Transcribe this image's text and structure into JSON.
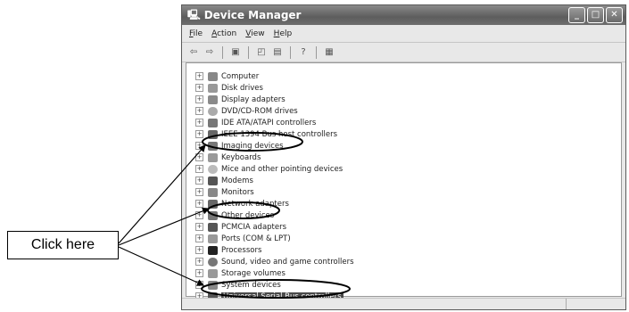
{
  "window": {
    "title": "Device Manager",
    "buttons": {
      "minimize": "_",
      "maximize": "□",
      "close": "✕"
    }
  },
  "menu": [
    "File",
    "Action",
    "View",
    "Help"
  ],
  "toolbar": [
    "back-icon",
    "forward-icon",
    "properties-icon",
    "refresh-icon",
    "print-icon",
    "help-icon",
    "scan-icon"
  ],
  "devices": [
    {
      "label": "Computer",
      "icon": "computer-icon"
    },
    {
      "label": "Disk drives",
      "icon": "disk-icon"
    },
    {
      "label": "Display adapters",
      "icon": "display-icon"
    },
    {
      "label": "DVD/CD-ROM drives",
      "icon": "dvd-icon"
    },
    {
      "label": "IDE ATA/ATAPI controllers",
      "icon": "ide-icon"
    },
    {
      "label": "IEEE 1394 Bus host controllers",
      "icon": "ieee-icon"
    },
    {
      "label": "Imaging devices",
      "icon": "camera-icon"
    },
    {
      "label": "Keyboards",
      "icon": "keyboard-icon"
    },
    {
      "label": "Mice and other pointing devices",
      "icon": "mouse-icon"
    },
    {
      "label": "Modems",
      "icon": "modem-icon"
    },
    {
      "label": "Monitors",
      "icon": "monitor-icon"
    },
    {
      "label": "Network adapters",
      "icon": "network-icon"
    },
    {
      "label": "Other devices",
      "icon": "other-devices-icon"
    },
    {
      "label": "PCMCIA adapters",
      "icon": "pcmcia-icon"
    },
    {
      "label": "Ports (COM & LPT)",
      "icon": "port-icon"
    },
    {
      "label": "Processors",
      "icon": "processor-icon"
    },
    {
      "label": "Sound, video and game controllers",
      "icon": "sound-icon"
    },
    {
      "label": "Storage volumes",
      "icon": "storage-icon"
    },
    {
      "label": "System devices",
      "icon": "system-icon"
    },
    {
      "label": "Universal Serial Bus controllers",
      "icon": "usb-icon",
      "selected": true
    }
  ],
  "annotation": {
    "label": "Click here"
  }
}
